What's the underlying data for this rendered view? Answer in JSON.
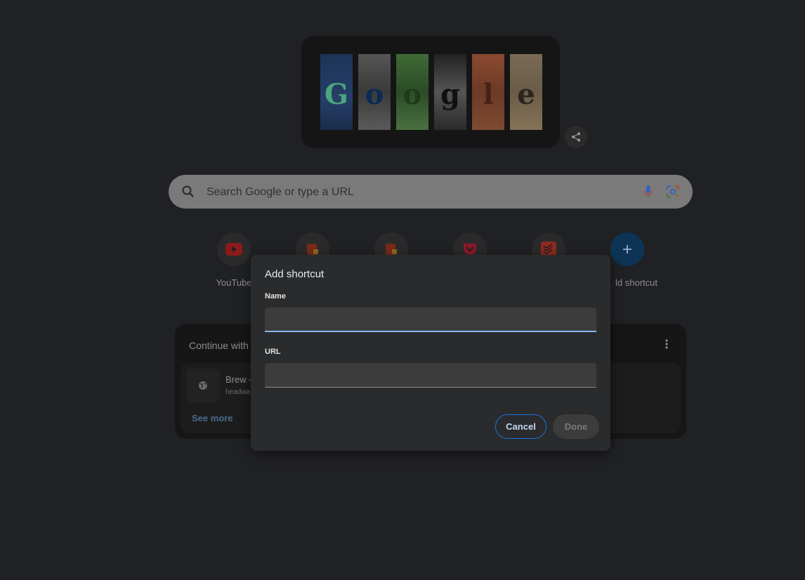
{
  "search": {
    "placeholder": "Search Google or type a URL"
  },
  "shortcuts": [
    {
      "label": "YouTube",
      "icon": "youtube-icon"
    },
    {
      "label": "",
      "icon": "bookmark-icon"
    },
    {
      "label": "",
      "icon": "bookmark-icon"
    },
    {
      "label": "",
      "icon": "pocket-icon"
    },
    {
      "label": "",
      "icon": "todoist-icon"
    },
    {
      "label": "ld shortcut",
      "icon": "add-icon"
    }
  ],
  "continue_card": {
    "title": "Continue with t",
    "item_title": "Brew –",
    "item_url": "headwa",
    "see_more": "See more"
  },
  "dialog": {
    "title": "Add shortcut",
    "name_label": "Name",
    "name_value": "",
    "url_label": "URL",
    "url_value": "",
    "cancel_label": "Cancel",
    "done_label": "Done"
  },
  "colors": {
    "accent": "#8ab4f8",
    "button_border": "#1a73e8"
  }
}
